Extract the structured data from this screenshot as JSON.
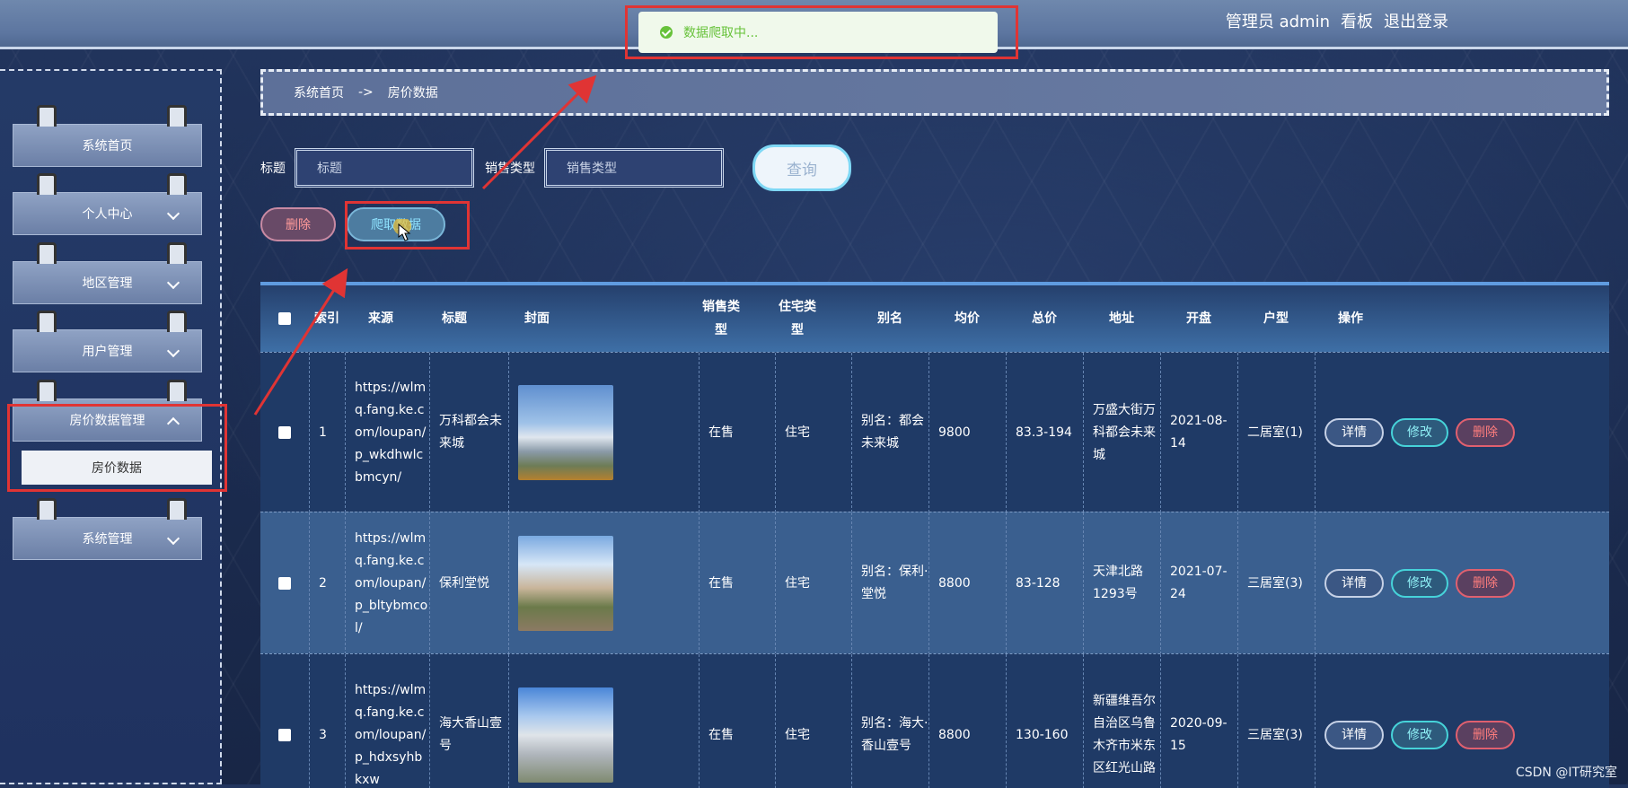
{
  "header": {
    "user_label": "管理员 admin",
    "board_label": "看板",
    "logout_label": "退出登录"
  },
  "toast": {
    "message": "数据爬取中..."
  },
  "sidebar": {
    "items": [
      {
        "label": "系统首页"
      },
      {
        "label": "个人中心"
      },
      {
        "label": "地区管理"
      },
      {
        "label": "用户管理"
      },
      {
        "label": "房价数据管理"
      },
      {
        "label": "系统管理"
      }
    ],
    "submenu_label": "房价数据"
  },
  "breadcrumb": {
    "home": "系统首页",
    "sep": "->",
    "current": "房价数据"
  },
  "search": {
    "title_label": "标题",
    "title_placeholder": "标题",
    "type_label": "销售类型",
    "type_placeholder": "销售类型",
    "query_label": "查询"
  },
  "actions": {
    "delete_label": "删除",
    "crawl_label": "爬取数据"
  },
  "table": {
    "headers": [
      "",
      "索引",
      "来源",
      "标题",
      "封面",
      "销售类型",
      "住宅类型",
      "别名",
      "均价",
      "总价",
      "地址",
      "开盘",
      "户型",
      "操作"
    ],
    "rows": [
      {
        "index": "1",
        "source": "https://wlmq.fang.ke.com/loupan/p_wkdhwlcbmcyn/",
        "title": "万科都会未来城",
        "sale_type": "在售",
        "house_type": "住宅",
        "alias": "别名：都会未来城",
        "avg_price": "9800",
        "total_price": "83.3-194",
        "address": "万盛大街万科都会未来城",
        "open_date": "2021-08-14",
        "layout": "二居室(1)"
      },
      {
        "index": "2",
        "source": "https://wlmq.fang.ke.com/loupan/p_bltybmcol/",
        "title": "保利堂悦",
        "sale_type": "在售",
        "house_type": "住宅",
        "alias": "别名：保利·堂悦",
        "avg_price": "8800",
        "total_price": "83-128",
        "address": "天津北路1293号",
        "open_date": "2021-07-24",
        "layout": "三居室(3)"
      },
      {
        "index": "3",
        "source": "https://wlmq.fang.ke.com/loupan/p_hdxsyhbkxw",
        "title": "海大香山壹号",
        "sale_type": "在售",
        "house_type": "住宅",
        "alias": "别名：海大·香山壹号",
        "avg_price": "8800",
        "total_price": "130-160",
        "address": "新疆维吾尔自治区乌鲁木齐市米东区红光山路",
        "open_date": "2020-09-15",
        "layout": "三居室(3)"
      }
    ],
    "row_buttons": {
      "detail": "详情",
      "edit": "修改",
      "delete": "删除"
    }
  },
  "watermark": "CSDN @IT研究室",
  "colors": {
    "highlight": "#e03434",
    "accent": "#5f9be0",
    "success": "#67c23a"
  }
}
